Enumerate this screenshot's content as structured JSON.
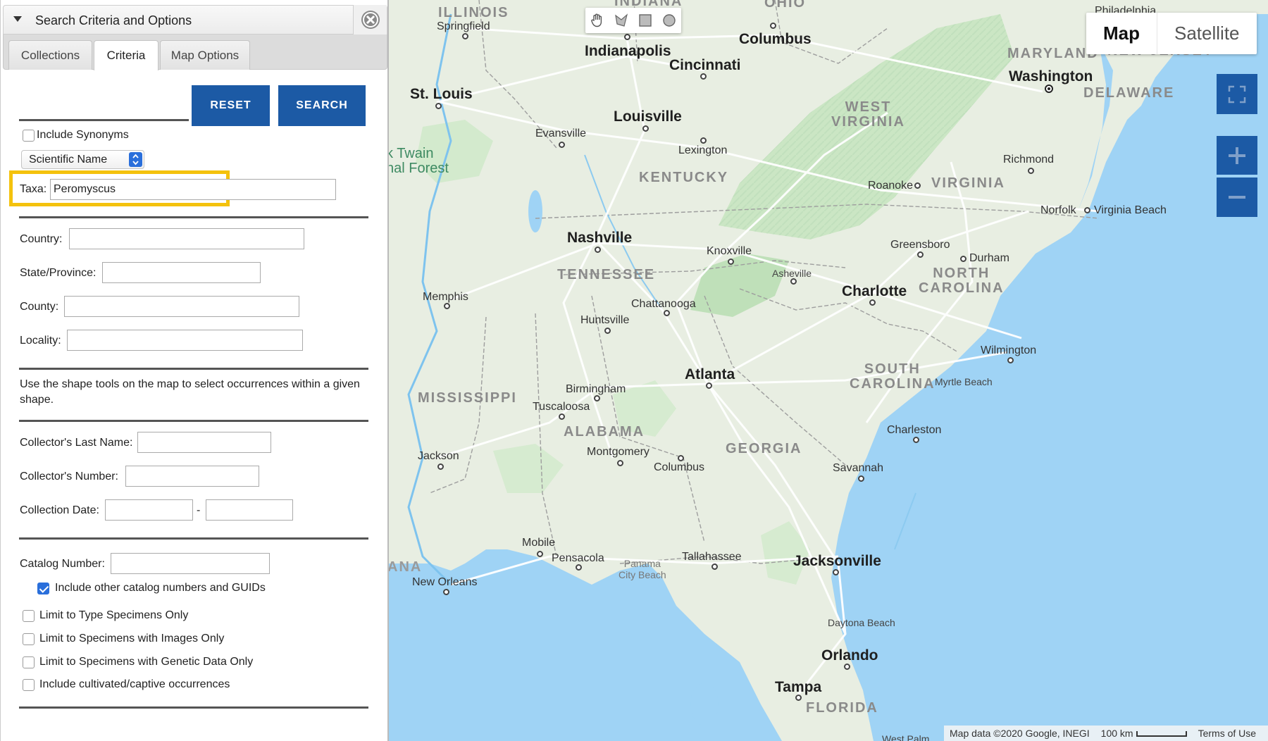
{
  "panel": {
    "title": "Search Criteria and Options",
    "tabs": {
      "collections": "Collections",
      "criteria": "Criteria",
      "map_options": "Map Options"
    },
    "reset_label": "RESET",
    "search_label": "SEARCH",
    "include_synonyms": "Include Synonyms",
    "taxon_type": "Scientific Name",
    "taxa_label": "Taxa:",
    "taxa_value": "Peromyscus",
    "country_label": "Country:",
    "state_label": "State/Province:",
    "county_label": "County:",
    "locality_label": "Locality:",
    "shape_note": "Use the shape tools on the map to select occurrences within a given shape.",
    "collector_last_label": "Collector's Last Name:",
    "collector_number_label": "Collector's Number:",
    "collection_date_label": "Collection Date:",
    "date_sep": "-",
    "catalog_label": "Catalog Number:",
    "include_other_catalog": "Include other catalog numbers and GUIDs",
    "include_other_catalog_checked": true,
    "limit_type": "Limit to Type Specimens Only",
    "limit_images": "Limit to Specimens with Images Only",
    "limit_genetic": "Limit to Specimens with Genetic Data Only",
    "include_cultivated": "Include cultivated/captive occurrences",
    "accent_color": "#1c5aa5",
    "highlight_color": "#f4c20d"
  },
  "map": {
    "type_buttons": {
      "map": "Map",
      "satellite": "Satellite"
    },
    "footer": {
      "attribution": "Map data ©2020 Google, INEGI",
      "scale": "100 km",
      "terms": "Terms of Use"
    },
    "water_color": "#9fd3f5",
    "land_color": "#e9efe3",
    "states": {
      "illinois": "ILLINOIS",
      "indiana": "INDIANA",
      "ohio": "OHIO",
      "maryland": "MARYLAND",
      "new_jersey": "NEW JERSEY",
      "delaware": "DELAWARE",
      "west_virginia": "WEST\nVIRGINIA",
      "virginia": "VIRGINIA",
      "kentucky": "KENTUCKY",
      "tennessee": "TENNESSEE",
      "north_carolina": "NORTH\nCAROLINA",
      "south_carolina": "SOUTH\nCAROLINA",
      "mississippi": "MISSISSIPPI",
      "alabama": "ALABAMA",
      "georgia": "GEORGIA",
      "louisiana_cut": "ANA",
      "florida": "FLORIDA"
    },
    "park": "k Twain\nnal Forest",
    "cities": {
      "springfield": "Springfield",
      "philadelphia": "Philadelphia",
      "indianapolis": "Indianapolis",
      "columbus_oh": "Columbus",
      "cincinnati": "Cincinnati",
      "washington": "Washington",
      "st_louis": "St. Louis",
      "louisville": "Louisville",
      "evansville": "Evansville",
      "lexington": "Lexington",
      "richmond": "Richmond",
      "roanoke": "Roanoke",
      "norfolk": "Norfolk",
      "virginia_beach": "Virginia Beach",
      "nashville": "Nashville",
      "knoxville": "Knoxville",
      "greensboro": "Greensboro",
      "durham": "Durham",
      "asheville": "Asheville",
      "memphis": "Memphis",
      "charlotte": "Charlotte",
      "chattanooga": "Chattanooga",
      "huntsville": "Huntsville",
      "wilmington": "Wilmington",
      "atlanta": "Atlanta",
      "birmingham": "Birmingham",
      "myrtle_beach": "Myrtle Beach",
      "tuscaloosa": "Tuscaloosa",
      "charleston": "Charleston",
      "jackson": "Jackson",
      "montgomery": "Montgomery",
      "columbus_ga": "Columbus",
      "savannah": "Savannah",
      "mobile": "Mobile",
      "pensacola": "Pensacola",
      "panama_city": "Panama\nCity Beach",
      "tallahassee": "Tallahassee",
      "jacksonville": "Jacksonville",
      "new_orleans": "New Orleans",
      "daytona": "Daytona Beach",
      "orlando": "Orlando",
      "tampa": "Tampa",
      "west_palm": "West Palm"
    }
  }
}
